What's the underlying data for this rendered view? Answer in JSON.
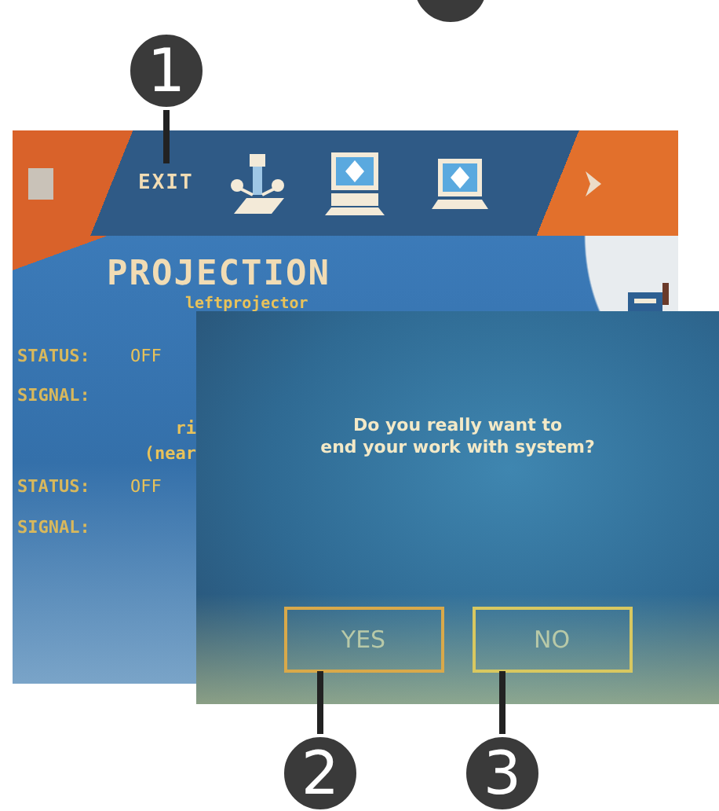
{
  "callouts": [
    {
      "label": "1"
    },
    {
      "label": "2"
    },
    {
      "label": "3"
    }
  ],
  "main_screen": {
    "toolbar": {
      "exit_label": "EXIT"
    },
    "panel": {
      "title": "PROJECTION",
      "subtitle": "leftprojector",
      "rows": [
        {
          "kind": "field",
          "label": "STATUS:",
          "value": "OFF"
        },
        {
          "kind": "field",
          "label": "SIGNAL:"
        },
        {
          "kind": "note",
          "text": "ri"
        },
        {
          "kind": "note",
          "text": "(near"
        },
        {
          "kind": "field",
          "label": "STATUS:",
          "value": "OFF"
        },
        {
          "kind": "field",
          "label": "SIGNAL:"
        }
      ]
    }
  },
  "dialog": {
    "message_lines": [
      "Do you really want to",
      "end your work with system?"
    ],
    "buttons": [
      {
        "label": "YES"
      },
      {
        "label": "NO"
      }
    ]
  }
}
